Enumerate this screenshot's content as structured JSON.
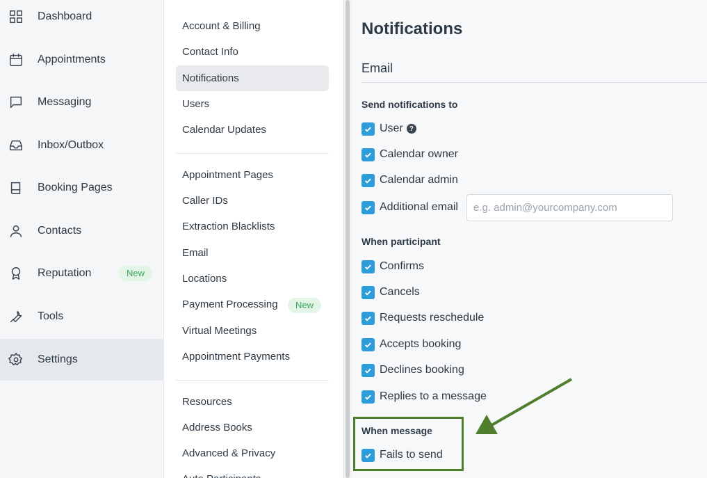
{
  "nav": {
    "items": [
      {
        "label": "Dashboard",
        "icon": "dashboard-grid-icon"
      },
      {
        "label": "Appointments",
        "icon": "calendar-icon"
      },
      {
        "label": "Messaging",
        "icon": "chat-bubble-icon"
      },
      {
        "label": "Inbox/Outbox",
        "icon": "inbox-icon"
      },
      {
        "label": "Booking Pages",
        "icon": "book-icon"
      },
      {
        "label": "Contacts",
        "icon": "person-icon"
      },
      {
        "label": "Reputation",
        "icon": "award-icon",
        "badge": "New"
      },
      {
        "label": "Tools",
        "icon": "wrench-icon"
      },
      {
        "label": "Settings",
        "icon": "gear-icon",
        "active": true
      }
    ]
  },
  "settings_menu": {
    "group1": [
      "Account & Billing",
      "Contact Info",
      "Notifications",
      "Users",
      "Calendar Updates"
    ],
    "group2": [
      "Appointment Pages",
      "Caller IDs",
      "Extraction Blacklists",
      "Email",
      "Locations",
      "Payment Processing",
      "Virtual Meetings",
      "Appointment Payments"
    ],
    "group2_badge": "New",
    "group3": [
      "Resources",
      "Address Books",
      "Advanced & Privacy",
      "Auto Participants"
    ]
  },
  "main": {
    "title": "Notifications",
    "section": "Email",
    "send_to": {
      "label": "Send notifications to",
      "options": [
        "User",
        "Calendar owner",
        "Calendar admin",
        "Additional email"
      ],
      "email_placeholder": "e.g. admin@yourcompany.com"
    },
    "participant": {
      "label": "When participant",
      "options": [
        "Confirms",
        "Cancels",
        "Requests reschedule",
        "Accepts booking",
        "Declines booking",
        "Replies to a message"
      ]
    },
    "message": {
      "label": "When message",
      "options": [
        "Fails to send"
      ]
    }
  },
  "colors": {
    "accent": "#2d9cdb",
    "highlight": "#4f7f2c",
    "badge_bg": "#e2f5e7",
    "badge_text": "#3aa55a"
  }
}
